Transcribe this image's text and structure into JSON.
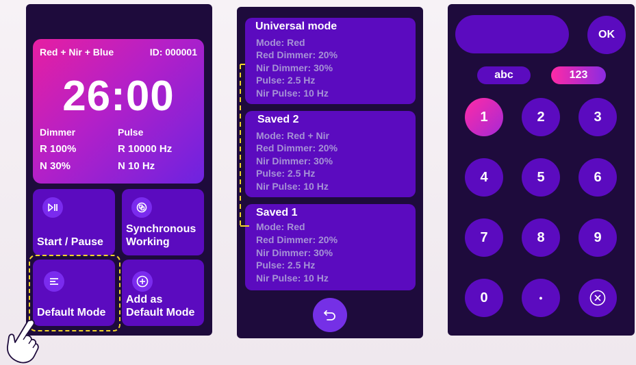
{
  "control": {
    "program": "Red + Nir + Blue",
    "device_id": "ID: 000001",
    "timer": "26:00",
    "dimmer_label": "Dimmer",
    "pulse_label": "Pulse",
    "dimmer_red": "R 100%",
    "dimmer_nir": "N 30%",
    "pulse_red": "R 10000 Hz",
    "pulse_nir": "N 10 Hz",
    "start_pause_label": "Start / Pause",
    "sync_line1": "Synchronous",
    "sync_line2": "Working",
    "default_mode_label": "Default Mode",
    "add_default_line1": "Add as",
    "add_default_line2": "Default Mode"
  },
  "modes": [
    {
      "title": "Universal mode",
      "lines": [
        "Mode:  Red",
        "Red Dimmer:  20%",
        "Nir Dimmer:  30%",
        "Pulse:  2.5 Hz",
        "Nir Pulse:  10 Hz"
      ]
    },
    {
      "title": "Saved 2",
      "lines": [
        "Mode:  Red + Nir",
        "Red Dimmer:  20%",
        "Nir Dimmer:  30%",
        "Pulse:  2.5 Hz",
        "Nir Pulse:  10 Hz"
      ]
    },
    {
      "title": "Saved 1",
      "lines": [
        "Mode:  Red",
        "Red Dimmer:  20%",
        "Nir Dimmer:  30%",
        "Pulse:  2.5 Hz",
        "Nir Pulse:  10 Hz"
      ]
    }
  ],
  "keypad": {
    "display_value": "",
    "ok_label": "OK",
    "abc_label": "abc",
    "num_label": "123",
    "keys": [
      "1",
      "2",
      "3",
      "4",
      "5",
      "6",
      "7",
      "8",
      "9",
      "0",
      "•"
    ],
    "active_key": "1"
  },
  "icons": {
    "play_pause": "play-pause-icon",
    "sync": "sync-icon",
    "default_mode": "list-icon",
    "add": "plus-circle-icon",
    "back": "undo-arrow-icon",
    "backspace": "close-circle-icon",
    "hand": "pointing-hand-icon"
  },
  "colors": {
    "panel_bg": "#1e0b3c",
    "button_bg": "#5b0bbf",
    "accent_pink": "#e61fa2",
    "accent_purple": "#6d23e0",
    "highlight_dash": "#f1d52a",
    "muted_text": "#a693d6"
  }
}
